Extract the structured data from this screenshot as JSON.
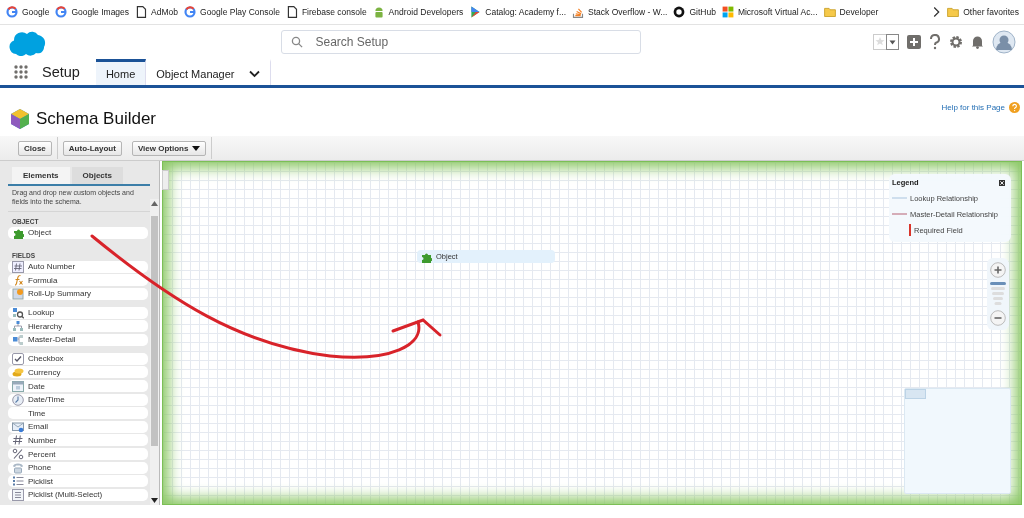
{
  "bookmarks": [
    {
      "label": "Google"
    },
    {
      "label": "Google Images"
    },
    {
      "label": "AdMob"
    },
    {
      "label": "Google Play Console"
    },
    {
      "label": "Firebase console"
    },
    {
      "label": "Android Developers"
    },
    {
      "label": "Catalog: Academy f..."
    },
    {
      "label": "Stack Overflow - W..."
    },
    {
      "label": "GitHub"
    },
    {
      "label": "Microsoft Virtual Ac..."
    },
    {
      "label": "Developer"
    }
  ],
  "other_favorites": {
    "label": "Other favorites"
  },
  "header": {
    "search": {
      "placeholder": "Search Setup"
    }
  },
  "nav": {
    "app_name": "Setup",
    "tabs": [
      {
        "label": "Home",
        "selected": true
      },
      {
        "label": "Object Manager",
        "selected": false
      }
    ]
  },
  "page": {
    "title": "Schema Builder",
    "help_link": "Help for this Page"
  },
  "toolbar": {
    "buttons": [
      "Close",
      "Auto-Layout",
      "View Options"
    ]
  },
  "palette": {
    "tabs": [
      {
        "label": "Elements",
        "selected": true
      },
      {
        "label": "Objects",
        "selected": false
      }
    ],
    "hint": "Drag and drop new custom objects and fields into the schema.",
    "sections": [
      {
        "heading": "OBJECT",
        "groups": [
          {
            "items": [
              {
                "label": "Object"
              }
            ]
          }
        ]
      },
      {
        "heading": "FIELDS",
        "groups": [
          {
            "items": [
              {
                "label": "Auto Number"
              },
              {
                "label": "Formula"
              },
              {
                "label": "Roll-Up Summary"
              }
            ]
          },
          {
            "items": [
              {
                "label": "Lookup"
              },
              {
                "label": "Hierarchy"
              },
              {
                "label": "Master-Detail"
              }
            ]
          },
          {
            "items": [
              {
                "label": "Checkbox"
              },
              {
                "label": "Currency"
              },
              {
                "label": "Date"
              },
              {
                "label": "Date/Time"
              },
              {
                "label": "Time"
              },
              {
                "label": "Email"
              },
              {
                "label": "Number"
              },
              {
                "label": "Percent"
              },
              {
                "label": "Phone"
              },
              {
                "label": "Picklist"
              },
              {
                "label": "Picklist (Multi-Select)"
              }
            ]
          }
        ]
      }
    ]
  },
  "canvas": {
    "nodes": [
      {
        "label": "Object"
      }
    ],
    "legend": {
      "title": "Legend",
      "entries": [
        {
          "kind": "lookup",
          "label": "Lookup Relationship"
        },
        {
          "kind": "master-detail",
          "label": "Master-Detail Relationship"
        },
        {
          "kind": "required",
          "label": "Required Field"
        }
      ]
    }
  }
}
